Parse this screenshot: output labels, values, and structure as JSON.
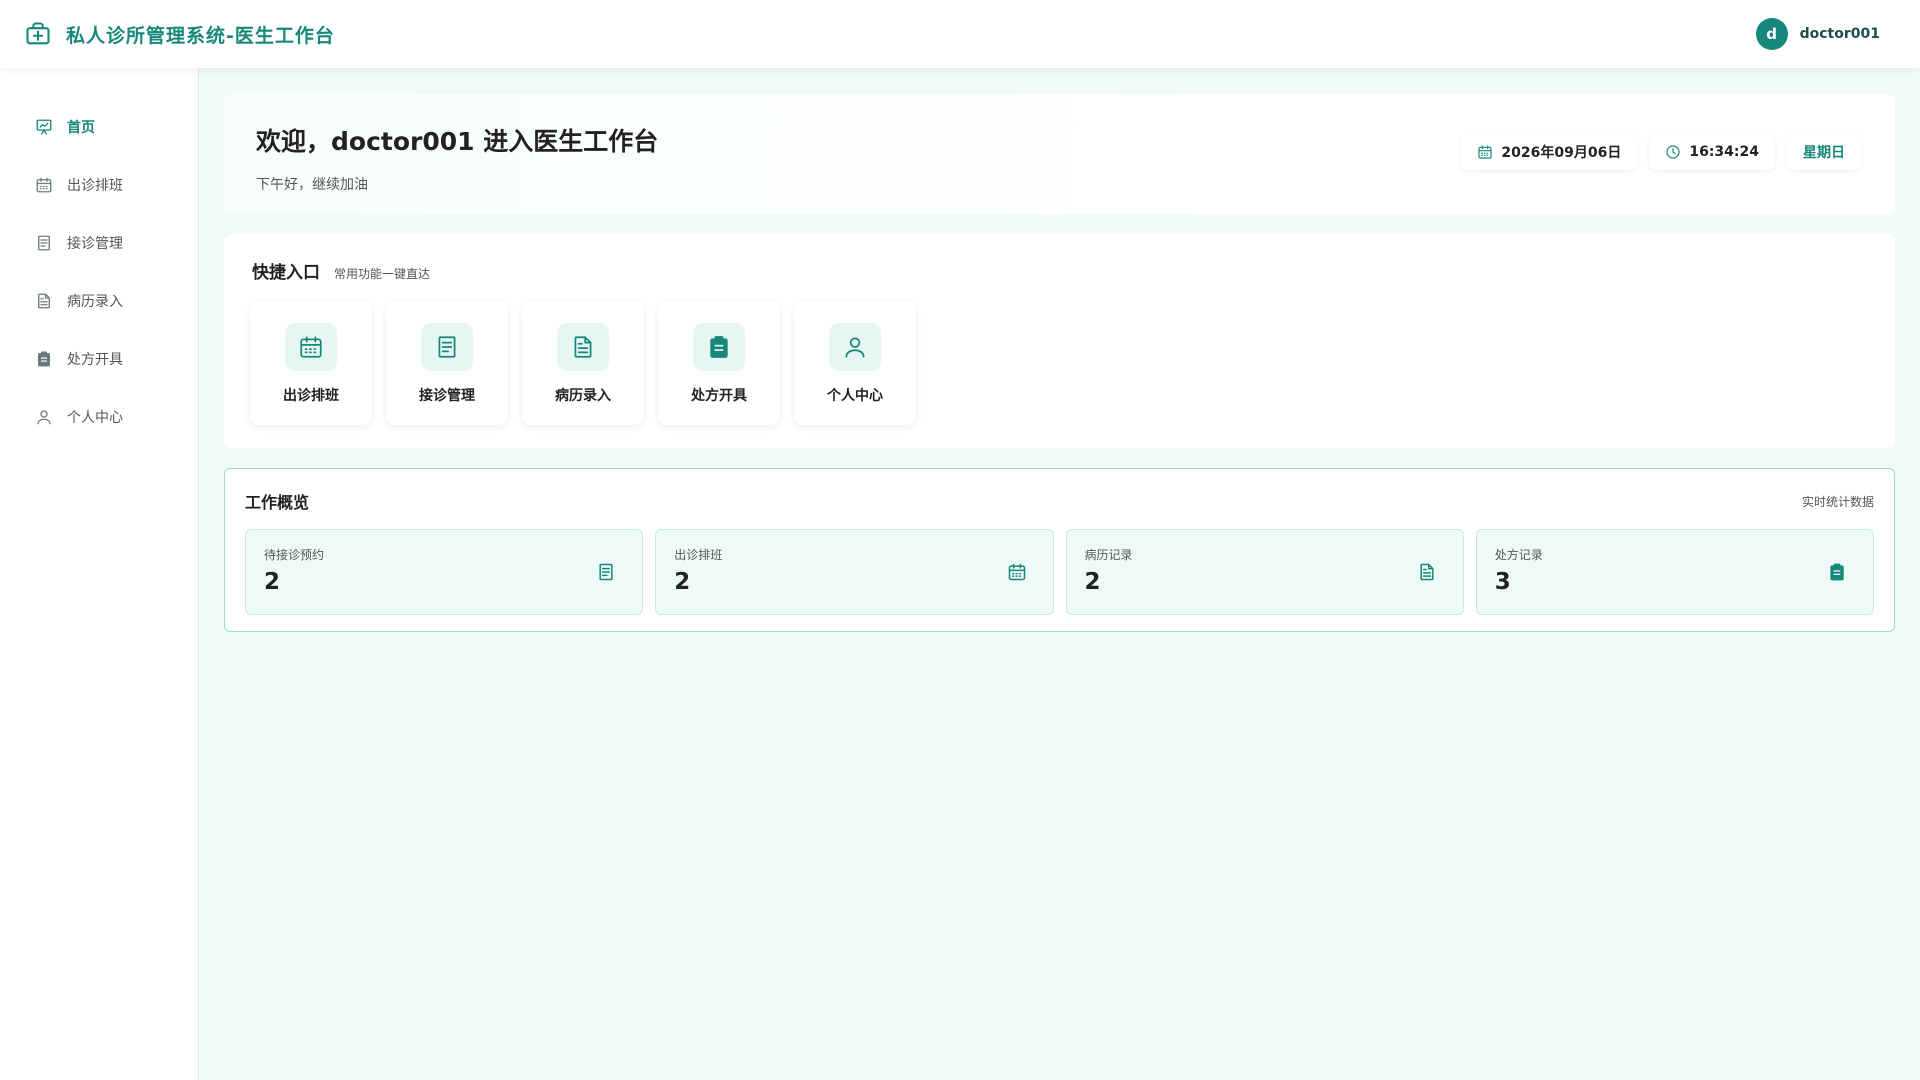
{
  "header": {
    "title": "私人诊所管理系统-医生工作台",
    "avatar_letter": "d",
    "username": "doctor001"
  },
  "sidebar": {
    "items": [
      {
        "label": "首页",
        "icon": "chart-icon",
        "active": true
      },
      {
        "label": "出诊排班",
        "icon": "calendar-icon"
      },
      {
        "label": "接诊管理",
        "icon": "document-list-icon"
      },
      {
        "label": "病历录入",
        "icon": "file-text-icon"
      },
      {
        "label": "处方开具",
        "icon": "clipboard-icon"
      },
      {
        "label": "个人中心",
        "icon": "user-icon"
      }
    ]
  },
  "welcome": {
    "title": "欢迎，doctor001 进入医生工作台",
    "subtitle": "下午好，继续加油",
    "date": "2026年09月06日",
    "time": "16:34:24",
    "weekday": "星期日"
  },
  "quick": {
    "title": "快捷入口",
    "hint": "常用功能一键直达",
    "items": [
      {
        "label": "出诊排班",
        "icon": "calendar-icon"
      },
      {
        "label": "接诊管理",
        "icon": "document-list-icon"
      },
      {
        "label": "病历录入",
        "icon": "file-text-icon"
      },
      {
        "label": "处方开具",
        "icon": "clipboard-icon"
      },
      {
        "label": "个人中心",
        "icon": "user-icon"
      }
    ]
  },
  "overview": {
    "title": "工作概览",
    "hint": "实时统计数据",
    "stats": [
      {
        "label": "待接诊预约",
        "value": "2",
        "icon": "document-list-icon"
      },
      {
        "label": "出诊排班",
        "value": "2",
        "icon": "calendar-icon"
      },
      {
        "label": "病历记录",
        "value": "2",
        "icon": "file-text-icon"
      },
      {
        "label": "处方记录",
        "value": "3",
        "icon": "clipboard-icon"
      }
    ]
  },
  "colors": {
    "accent": "#16877a",
    "page_bg": "#f0fbf8",
    "card_tint": "#eefaf7"
  }
}
